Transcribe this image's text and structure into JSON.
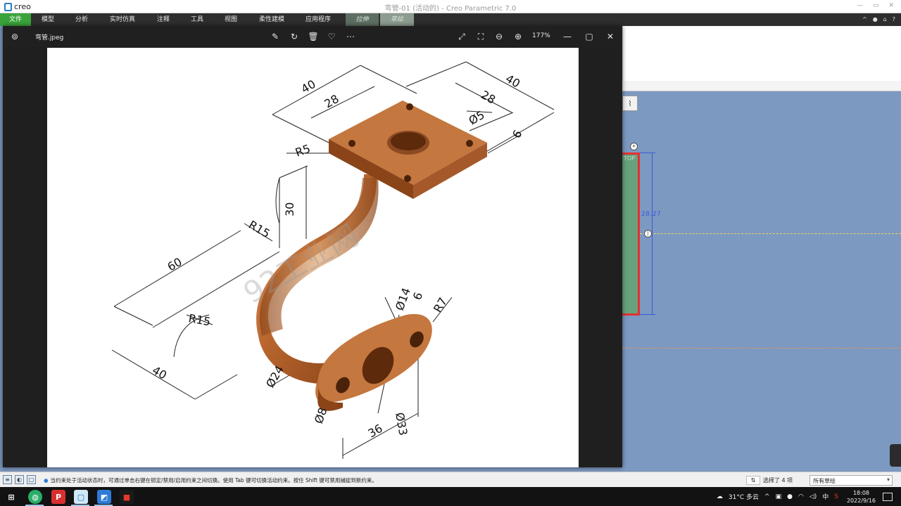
{
  "creo": {
    "logo": "creo",
    "window_title": "弯管-01 (活动的) - Creo Parametric 7.0",
    "window_controls": [
      "—",
      "▭",
      "✕"
    ],
    "menu_tabs": [
      "文件",
      "模型",
      "分析",
      "实时仿真",
      "注释",
      "工具",
      "视图",
      "柔性建模",
      "应用程序"
    ],
    "context_tabs": [
      "拉伸",
      "草绘"
    ],
    "ribbon_right_icons": [
      "^",
      "●",
      "⌂",
      "?"
    ],
    "sketch_button_icon": "sketch-references-icon",
    "sketch_plane_label": "TOP",
    "dimension_value": "28.27",
    "status_message": "当约束处于活动状态时，可通过单击右键在锁定/禁用/启用约束之间切换。使用 Tab 键可切换活动约束。按住 Shift 键可禁用捕捉到新约束。",
    "selection_count": "选择了 4 项",
    "filter_value": "所有草绘"
  },
  "viewer": {
    "filename": "弯管.jpeg",
    "zoom": "177%",
    "toolbar_icons": [
      "edit-icon",
      "rotate-icon",
      "delete-icon",
      "favorite-icon",
      "more-icon"
    ],
    "view_icons": [
      "fullscreen-icon",
      "fit-icon",
      "zoom-out-icon",
      "zoom-in-icon"
    ]
  },
  "drawing": {
    "labels": [
      "40",
      "28",
      "40",
      "28",
      "Ø5",
      "6",
      "R5",
      "30",
      "R15",
      "60",
      "R15",
      "40",
      "Ø24",
      "Ø14",
      "6",
      "R7",
      "Ø8",
      "Ø33",
      "36"
    ],
    "watermark": "92工业网"
  },
  "taskbar": {
    "apps": [
      "wechat-icon",
      "wps-icon",
      "notes-icon",
      "photos-icon",
      "recorder-icon"
    ],
    "weather": "31°C 多云",
    "ime": "中",
    "time": "18:08",
    "date": "2022/9/16"
  },
  "colors": {
    "file_tab": "#3aa33a",
    "canvas": "#7c99c1",
    "sketch_fill": "#67a27c",
    "sketch_border": "#e53030",
    "dimension": "#3a58d8",
    "copper": "#b5632d"
  }
}
